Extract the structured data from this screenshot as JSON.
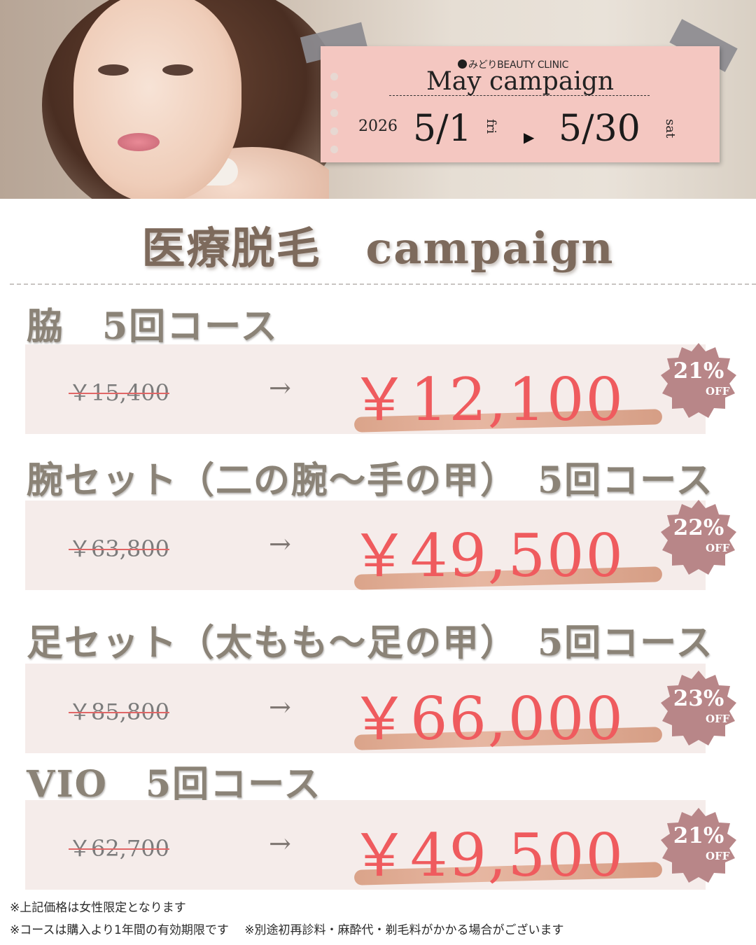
{
  "header": {
    "clinic_name": "みどりBEAUTY CLINIC",
    "campaign_title": "May campaign",
    "year": "2026",
    "start_date": "5/1",
    "start_day": "fri",
    "arrow": "▶",
    "end_date": "5/30",
    "end_day": "sat"
  },
  "main_title": "医療脱毛　campaign",
  "courses": [
    {
      "title": "脇　5回コース",
      "old_price": "￥15,400",
      "arrow": "→",
      "new_price": "￥12,100",
      "discount": "21%",
      "off": "OFF"
    },
    {
      "title": "腕セット（二の腕～手の甲）　5回コース",
      "old_price": "￥63,800",
      "arrow": "→",
      "new_price": "￥49,500",
      "discount": "22%",
      "off": "OFF"
    },
    {
      "title": "足セット（太もも～足の甲）　5回コース",
      "old_price": "￥85,800",
      "arrow": "→",
      "new_price": "￥66,000",
      "discount": "23%",
      "off": "OFF"
    },
    {
      "title": "VIO　5回コース",
      "old_price": "￥62,700",
      "arrow": "→",
      "new_price": "￥49,500",
      "discount": "21%",
      "off": "OFF"
    }
  ],
  "notes": {
    "line1": "※上記価格は女性限定となります",
    "line2": "※コースは購入より1年間の有効期限です　 ※別途初再診料・麻酔代・剃毛料がかかる場合がございます"
  },
  "colors": {
    "accent_price": "#ef5b5e",
    "badge": "#b88688",
    "card": "#f4c7c1",
    "band": "#f5ecea"
  }
}
